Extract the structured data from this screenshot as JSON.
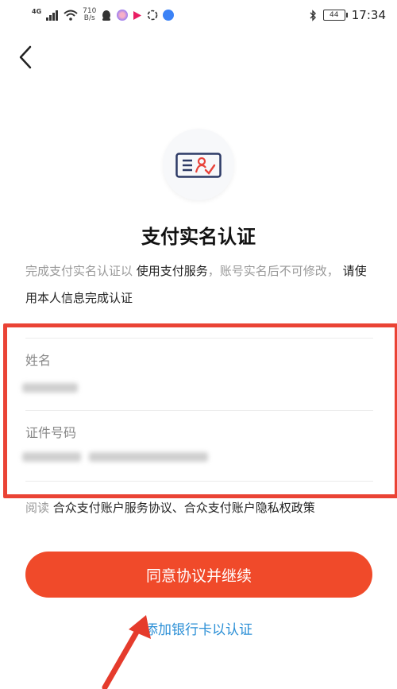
{
  "status_bar": {
    "network": "4G",
    "speed_value": "710",
    "speed_unit": "B/s",
    "battery": "44",
    "time": "17:34",
    "icons": [
      "signal-icon",
      "wifi-icon",
      "qq-icon",
      "app-icon",
      "video-icon",
      "circle-icon",
      "music-icon",
      "bluetooth-icon",
      "battery-icon"
    ]
  },
  "header": {
    "icon": "id-card-verify-icon",
    "title": "支付实名认证",
    "desc_part1": "完成支付实名认证以 ",
    "desc_strong1": "使用支付服务",
    "desc_part2": "，账号实名后不可修改，",
    "desc_strong2": " 请使用本人信息完成认证"
  },
  "form": {
    "name_label": "姓名",
    "id_label": "证件号码"
  },
  "agreement": {
    "prefix": "阅读 ",
    "terms": "合众支付账户服务协议、合众支付账户隐私权政策"
  },
  "actions": {
    "primary_button": "同意协议并继续",
    "alt_link": "添加银行卡以认证"
  },
  "colors": {
    "accent": "#f04a2a",
    "highlight_frame": "#ea4335",
    "link": "#2b8fd6"
  }
}
